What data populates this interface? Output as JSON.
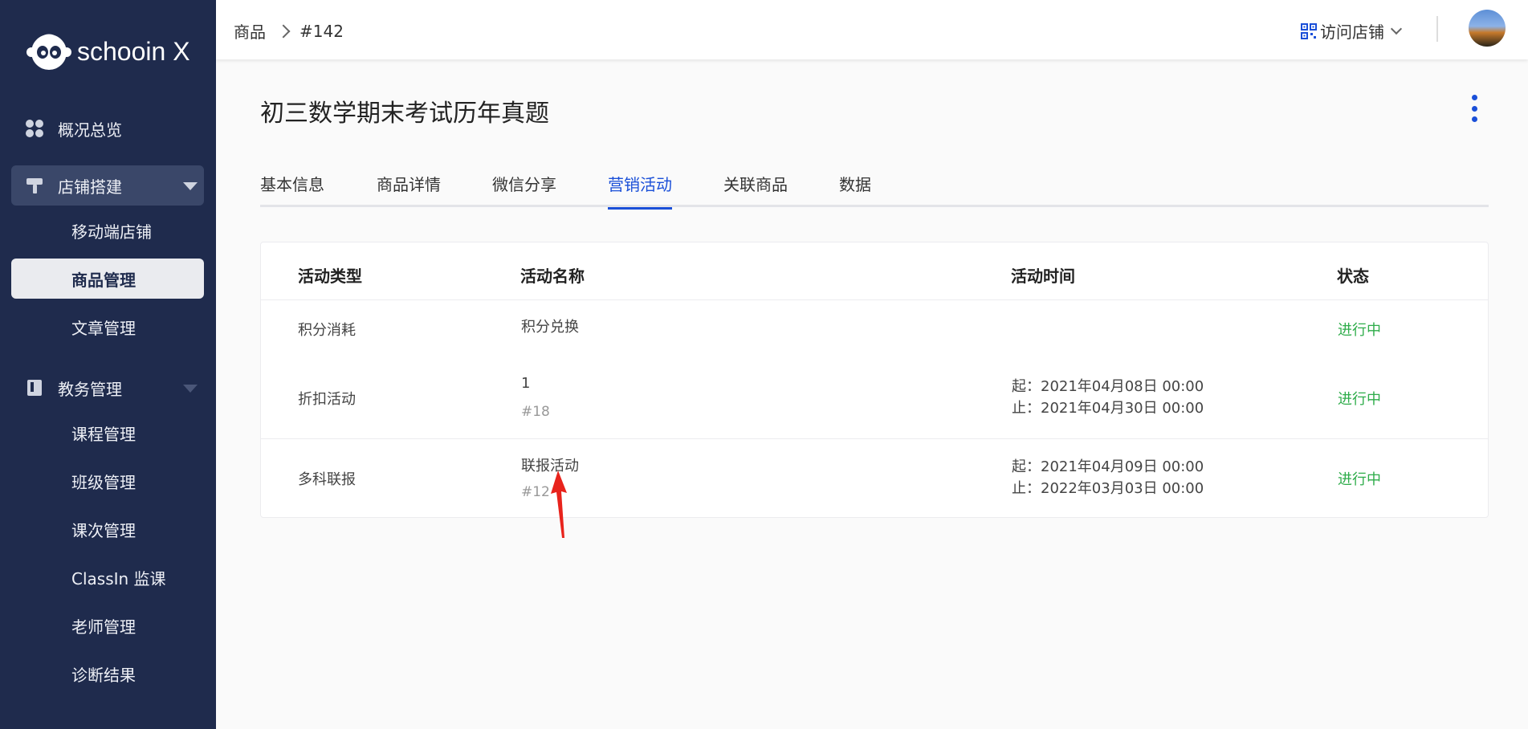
{
  "sidebar": {
    "brand": "schooin X",
    "items": [
      {
        "label": "概况总览",
        "icon": "dashboard-icon"
      },
      {
        "label": "店铺搭建",
        "icon": "paint-roller-icon"
      },
      {
        "label": "移动端店铺"
      },
      {
        "label": "商品管理"
      },
      {
        "label": "文章管理"
      },
      {
        "label": "教务管理",
        "icon": "book-icon"
      },
      {
        "label": "课程管理"
      },
      {
        "label": "班级管理"
      },
      {
        "label": "课次管理"
      },
      {
        "label": "ClassIn 监课"
      },
      {
        "label": "老师管理"
      },
      {
        "label": "诊断结果"
      }
    ]
  },
  "header": {
    "breadcrumb": [
      "商品",
      "#142"
    ],
    "visit_store": "访问店铺"
  },
  "page": {
    "title": "初三数学期末考试历年真题",
    "tabs": [
      "基本信息",
      "商品详情",
      "微信分享",
      "营销活动",
      "关联商品",
      "数据"
    ],
    "active_tab": "营销活动"
  },
  "table": {
    "headers": [
      "活动类型",
      "活动名称",
      "活动时间",
      "状态"
    ],
    "rows": [
      {
        "type": "积分消耗",
        "name": "积分兑换",
        "id": "",
        "start": "",
        "end": "",
        "status": "进行中"
      },
      {
        "type": "折扣活动",
        "name": "1",
        "id": "#18",
        "start": "起：2021年04月08日 00:00",
        "end": "止：2021年04月30日 00:00",
        "status": "进行中"
      },
      {
        "type": "多科联报",
        "name": "联报活动",
        "id": "#12",
        "start": "起：2021年04月09日 00:00",
        "end": "止：2022年03月03日 00:00",
        "status": "进行中"
      }
    ]
  },
  "colors": {
    "sidebar_bg": "#1f2b4d",
    "accent": "#1a4fd8",
    "status_green": "#2eac4a",
    "annotation_arrow": "#e8231c"
  }
}
